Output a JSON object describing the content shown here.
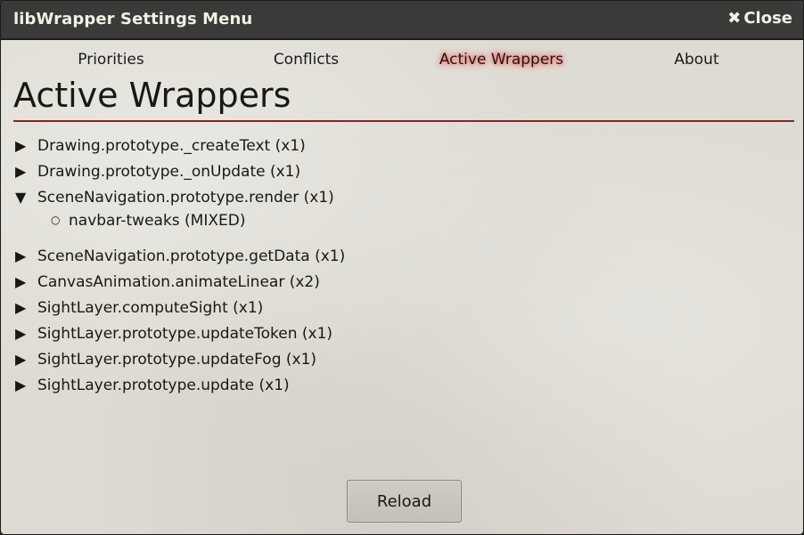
{
  "window": {
    "title": "libWrapper Settings Menu",
    "close_label": "Close",
    "close_icon": "times-icon"
  },
  "tabs": [
    {
      "label": "Priorities",
      "active": false
    },
    {
      "label": "Conflicts",
      "active": false
    },
    {
      "label": "Active Wrappers",
      "active": true
    },
    {
      "label": "About",
      "active": false
    }
  ],
  "page": {
    "title": "Active Wrappers"
  },
  "wrappers": [
    {
      "label": "Drawing.prototype._createText (x1)",
      "expanded": false
    },
    {
      "label": "Drawing.prototype._onUpdate (x1)",
      "expanded": false
    },
    {
      "label": "SceneNavigation.prototype.render (x1)",
      "expanded": true,
      "children": [
        {
          "label": "navbar-tweaks (MIXED)"
        }
      ]
    },
    {
      "label": "SceneNavigation.prototype.getData (x1)",
      "expanded": false
    },
    {
      "label": "CanvasAnimation.animateLinear (x2)",
      "expanded": false
    },
    {
      "label": "SightLayer.computeSight (x1)",
      "expanded": false
    },
    {
      "label": "SightLayer.prototype.updateToken (x1)",
      "expanded": false
    },
    {
      "label": "SightLayer.prototype.updateFog (x1)",
      "expanded": false
    },
    {
      "label": "SightLayer.prototype.update (x1)",
      "expanded": false
    }
  ],
  "footer": {
    "reload_label": "Reload"
  },
  "colors": {
    "header_bg": "#3a3a38",
    "divider": "#7d2a22",
    "active_tab_glow": "#ff3a3a"
  }
}
